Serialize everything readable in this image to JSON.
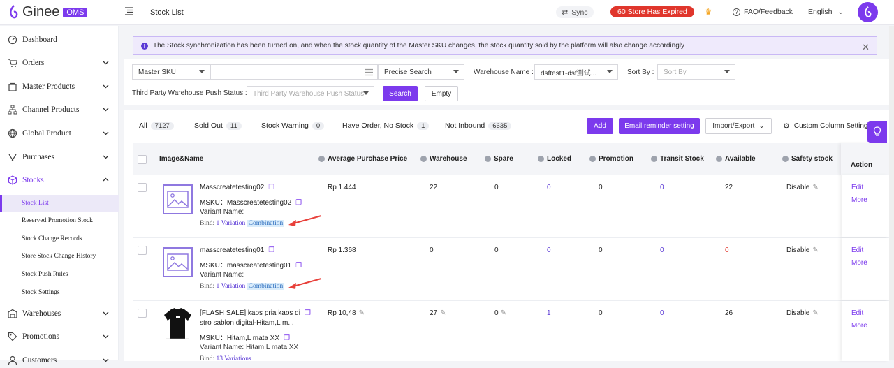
{
  "header": {
    "logo_text": "Ginee",
    "logo_badge": "OMS",
    "page_title": "Stock List",
    "sync_label": "Sync",
    "expired_label": "60 Store Has Expired",
    "faq_label": "FAQ/Feedback",
    "language": "English"
  },
  "sidebar": {
    "items": [
      {
        "label": "Dashboard",
        "icon": "dashboard-icon"
      },
      {
        "label": "Orders",
        "icon": "cart-icon"
      },
      {
        "label": "Master Products",
        "icon": "product-icon"
      },
      {
        "label": "Channel Products",
        "icon": "channel-icon"
      },
      {
        "label": "Global Product",
        "icon": "globe-icon"
      },
      {
        "label": "Purchases",
        "icon": "purchase-icon"
      },
      {
        "label": "Stocks",
        "icon": "box-icon"
      },
      {
        "label": "Warehouses",
        "icon": "warehouse-icon"
      },
      {
        "label": "Promotions",
        "icon": "tag-icon"
      },
      {
        "label": "Customers",
        "icon": "customer-icon"
      }
    ],
    "sub_items": [
      {
        "label": "Stock List"
      },
      {
        "label": "Reserved Promotion Stock"
      },
      {
        "label": "Stock Change Records"
      },
      {
        "label": "Store Stock Change History"
      },
      {
        "label": "Stock Push Rules"
      },
      {
        "label": "Stock Settings"
      }
    ]
  },
  "notice": {
    "text": "The Stock synchronization has been turned on, and when the stock quantity of the Master SKU changes, the stock quantity sold by the platform will also change accordingly"
  },
  "filters": {
    "search_type": "Master SKU",
    "search_mode": "Precise Search",
    "warehouse_label": "Warehouse Name :",
    "warehouse_value": "dsftest1-dsf测试...",
    "sort_label": "Sort By :",
    "sort_placeholder": "Sort By",
    "third_party_label": "Third Party Warehouse Push Status :",
    "third_party_placeholder": "Third Party Warehouse Push Status",
    "search_button": "Search",
    "empty_button": "Empty"
  },
  "tabs": [
    {
      "label": "All",
      "count": "7127"
    },
    {
      "label": "Sold Out",
      "count": "11"
    },
    {
      "label": "Stock Warning",
      "count": "0"
    },
    {
      "label": "Have Order, No Stock",
      "count": "1"
    },
    {
      "label": "Not Inbound",
      "count": "6635"
    }
  ],
  "toolbar": {
    "add": "Add",
    "email_reminder": "Email reminder setting",
    "import_export": "Import/Export",
    "custom_column": "Custom Column Setting"
  },
  "columns": {
    "image_name": "Image&Name",
    "avg_price": "Average Purchase Price",
    "warehouse": "Warehouse",
    "spare": "Spare",
    "locked": "Locked",
    "promotion": "Promotion",
    "transit": "Transit Stock",
    "available": "Available",
    "safety": "Safety stock",
    "action": "Action"
  },
  "rows": [
    {
      "name": "Masscreatetesting02",
      "msku": "MSKU：Masscreatetesting02",
      "variant": "Variant Name:",
      "bind_prefix": "Bind:",
      "bind_link": "1 Variation",
      "bind_tag": "Combination",
      "price": "Rp 1.444",
      "warehouse": "22",
      "spare": "0",
      "locked": "0",
      "promotion": "0",
      "transit": "0",
      "available": "22",
      "safety": "Disable",
      "edit": "Edit",
      "more": "More"
    },
    {
      "name": "masscreatetesting01",
      "msku": "MSKU：masscreatetesting01",
      "variant": "Variant Name:",
      "bind_prefix": "Bind:",
      "bind_link": "1 Variation",
      "bind_tag": "Combination",
      "price": "Rp 1.368",
      "warehouse": "0",
      "spare": "0",
      "locked": "0",
      "promotion": "0",
      "transit": "0",
      "available": "0",
      "safety": "Disable",
      "edit": "Edit",
      "more": "More"
    },
    {
      "name_line1": "[FLASH SALE] kaos pria kaos di",
      "name_line2": "stro sablon digital-Hitam,L m...",
      "msku": "MSKU：Hitam,L mata XX",
      "variant": "Variant Name: Hitam,L mata XX",
      "bind_prefix": "Bind:",
      "bind_link": "13 Variations",
      "price": "Rp 10,48",
      "warehouse": "27",
      "spare": "0",
      "locked": "1",
      "promotion": "0",
      "transit": "0",
      "available": "26",
      "safety": "Disable",
      "edit": "Edit",
      "more": "More"
    }
  ],
  "colors": {
    "accent": "#7c3aed",
    "danger": "#e0362c",
    "arrow": "#e8403a"
  }
}
